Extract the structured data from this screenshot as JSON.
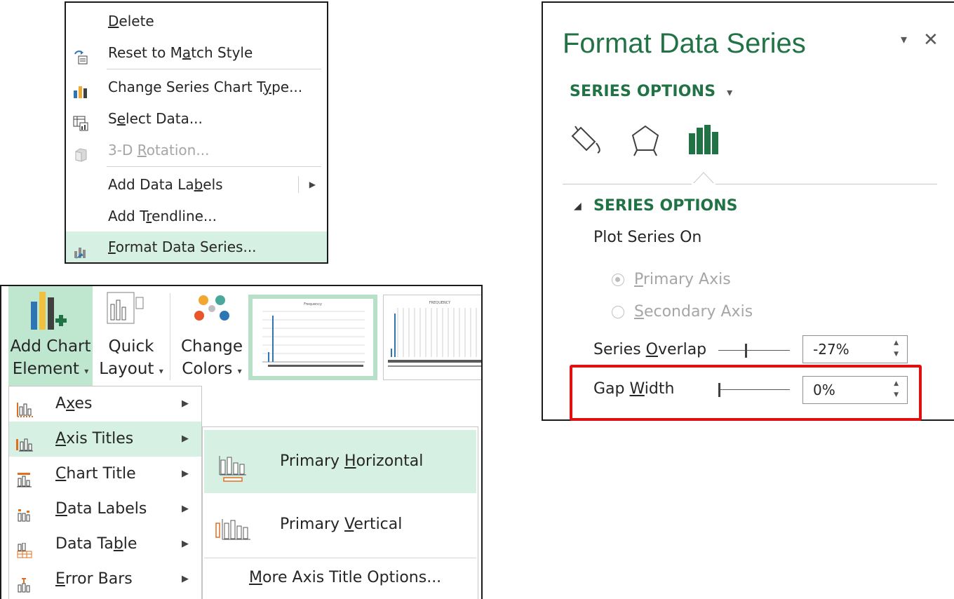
{
  "context_menu": {
    "items": [
      {
        "label": "Delete",
        "icon": "none"
      },
      {
        "label": "Reset to Match Style",
        "icon": "reset-style-icon"
      },
      {
        "label": "Change Series Chart Type...",
        "icon": "chart-type-icon"
      },
      {
        "label": "Select Data...",
        "icon": "select-data-icon"
      },
      {
        "label": "3-D Rotation...",
        "icon": "cube-icon",
        "disabled": true
      },
      {
        "label": "Add Data Labels",
        "icon": "none",
        "submenu": true
      },
      {
        "label": "Add Trendline...",
        "icon": "none"
      },
      {
        "label": "Format Data Series...",
        "icon": "format-series-icon",
        "highlighted": true
      }
    ]
  },
  "ribbon": {
    "add_chart_element": {
      "line1": "Add Chart",
      "line2": "Element"
    },
    "quick_layout": {
      "line1": "Quick",
      "line2": "Layout"
    },
    "change_colors": {
      "line1": "Change",
      "line2": "Colors"
    },
    "thumb1_title": "Frequency",
    "thumb2_title": "FREQUENCY",
    "dropdown_glyph": "▾",
    "menu": [
      {
        "label": "Axes",
        "icon": "axes-icon"
      },
      {
        "label": "Axis Titles",
        "icon": "axis-titles-icon",
        "highlighted": true
      },
      {
        "label": "Chart Title",
        "icon": "chart-title-icon"
      },
      {
        "label": "Data Labels",
        "icon": "data-labels-icon"
      },
      {
        "label": "Data Table",
        "icon": "data-table-icon"
      },
      {
        "label": "Error Bars",
        "icon": "error-bars-icon"
      }
    ],
    "submenu": {
      "items": [
        {
          "label": "Primary Horizontal",
          "icon": "primary-horizontal-icon",
          "highlighted": true
        },
        {
          "label": "Primary Vertical",
          "icon": "primary-vertical-icon"
        }
      ],
      "more": "More Axis Title Options..."
    }
  },
  "pane": {
    "title": "Format Data Series",
    "dropdown_glyph": "▾",
    "close_glyph": "✕",
    "series_dropdown": "SERIES OPTIONS",
    "section_title": "SERIES OPTIONS",
    "plot_series_on": "Plot Series On",
    "primary_axis": "Primary Axis",
    "secondary_axis": "Secondary Axis",
    "series_overlap_label": "Series Overlap",
    "series_overlap_value": "-27%",
    "gap_width_label": "Gap Width",
    "gap_width_value": "0%",
    "colors": {
      "accent": "#217346",
      "highlight": "#d6f0e3",
      "alert": "#e01010"
    }
  }
}
